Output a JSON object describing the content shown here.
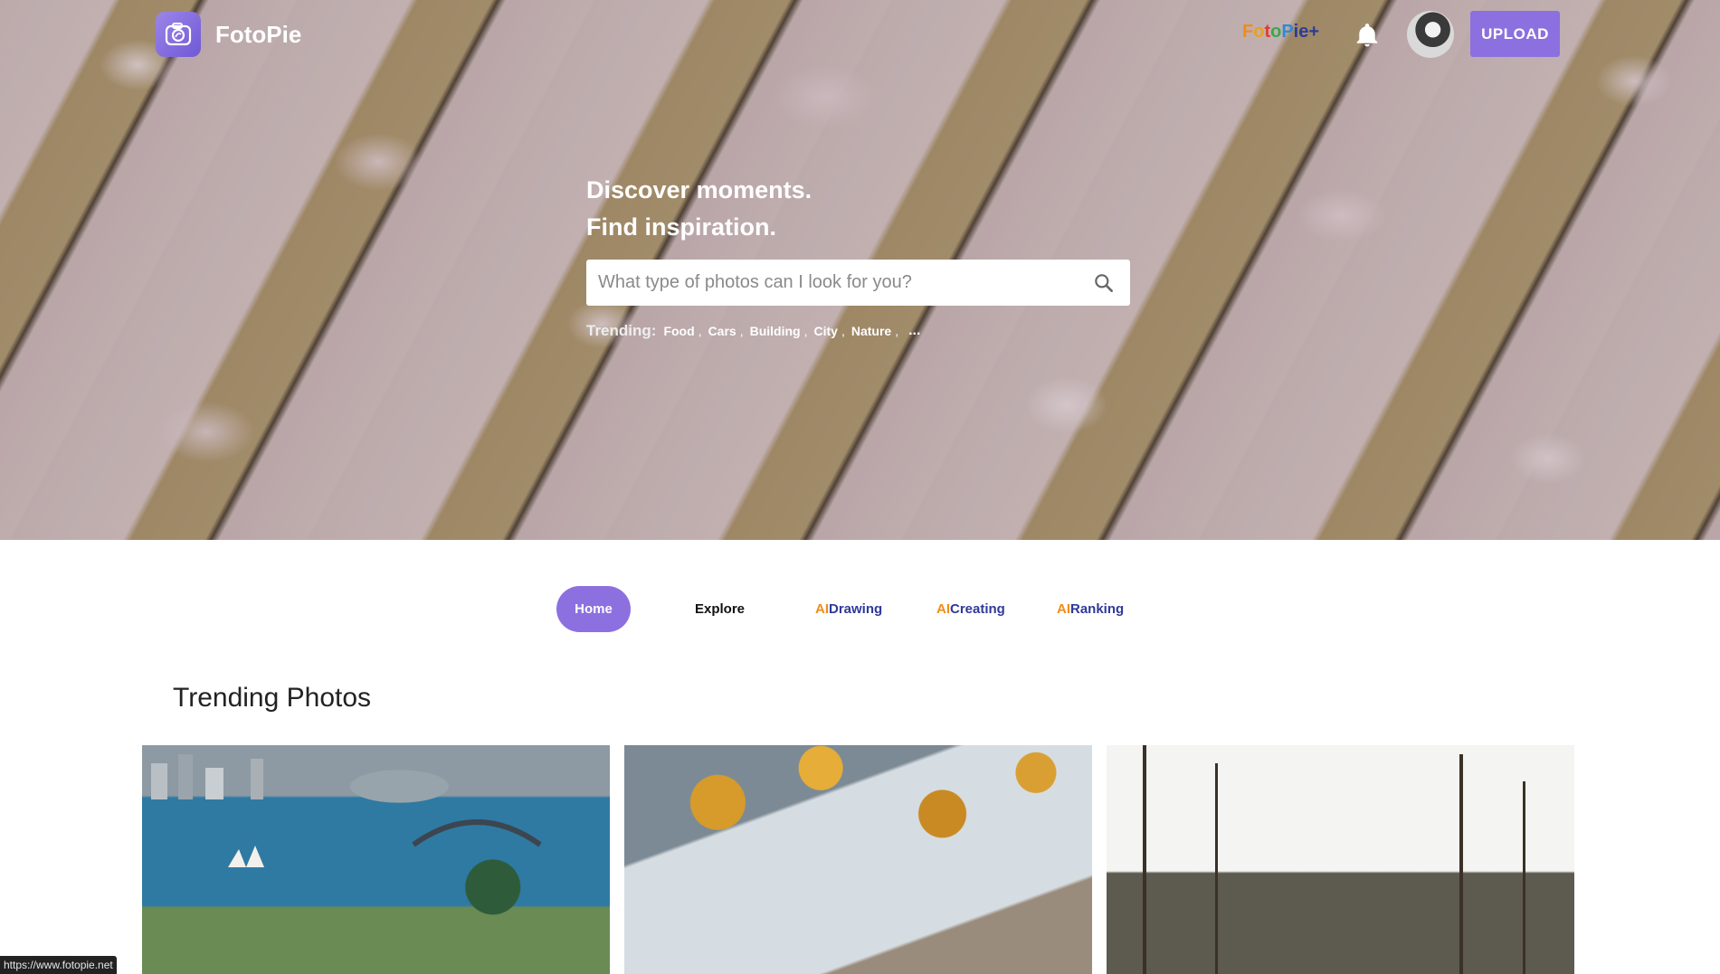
{
  "brand": {
    "name": "FotoPie"
  },
  "header": {
    "plus_link": [
      "F",
      "o",
      "t",
      "o",
      "P",
      "i",
      "e",
      "+"
    ],
    "upload_label": "UPLOAD"
  },
  "hero": {
    "tagline_line1": "Discover moments.",
    "tagline_line2": "Find inspiration.",
    "search_placeholder": "What type of photos can I look for you?",
    "trending_label": "Trending:",
    "trending_tags": [
      "Food",
      "Cars",
      "Building",
      "City",
      "Nature"
    ],
    "trending_more": "..."
  },
  "nav": {
    "home": "Home",
    "explore": "Explore",
    "ai_drawing": {
      "ai": "AI",
      "word": "Drawing"
    },
    "ai_creating": {
      "ai": "AI",
      "word": "Creating"
    },
    "ai_ranking": {
      "ai": "AI",
      "word": "Ranking"
    }
  },
  "section_title": "Trending Photos",
  "status_url": "https://www.fotopie.net",
  "colors": {
    "accent": "#8c70df",
    "ai_orange": "#f08c18",
    "ai_navy": "#2e3a9a"
  },
  "icons": [
    "camera-logo-icon",
    "bell-icon",
    "search-icon"
  ]
}
